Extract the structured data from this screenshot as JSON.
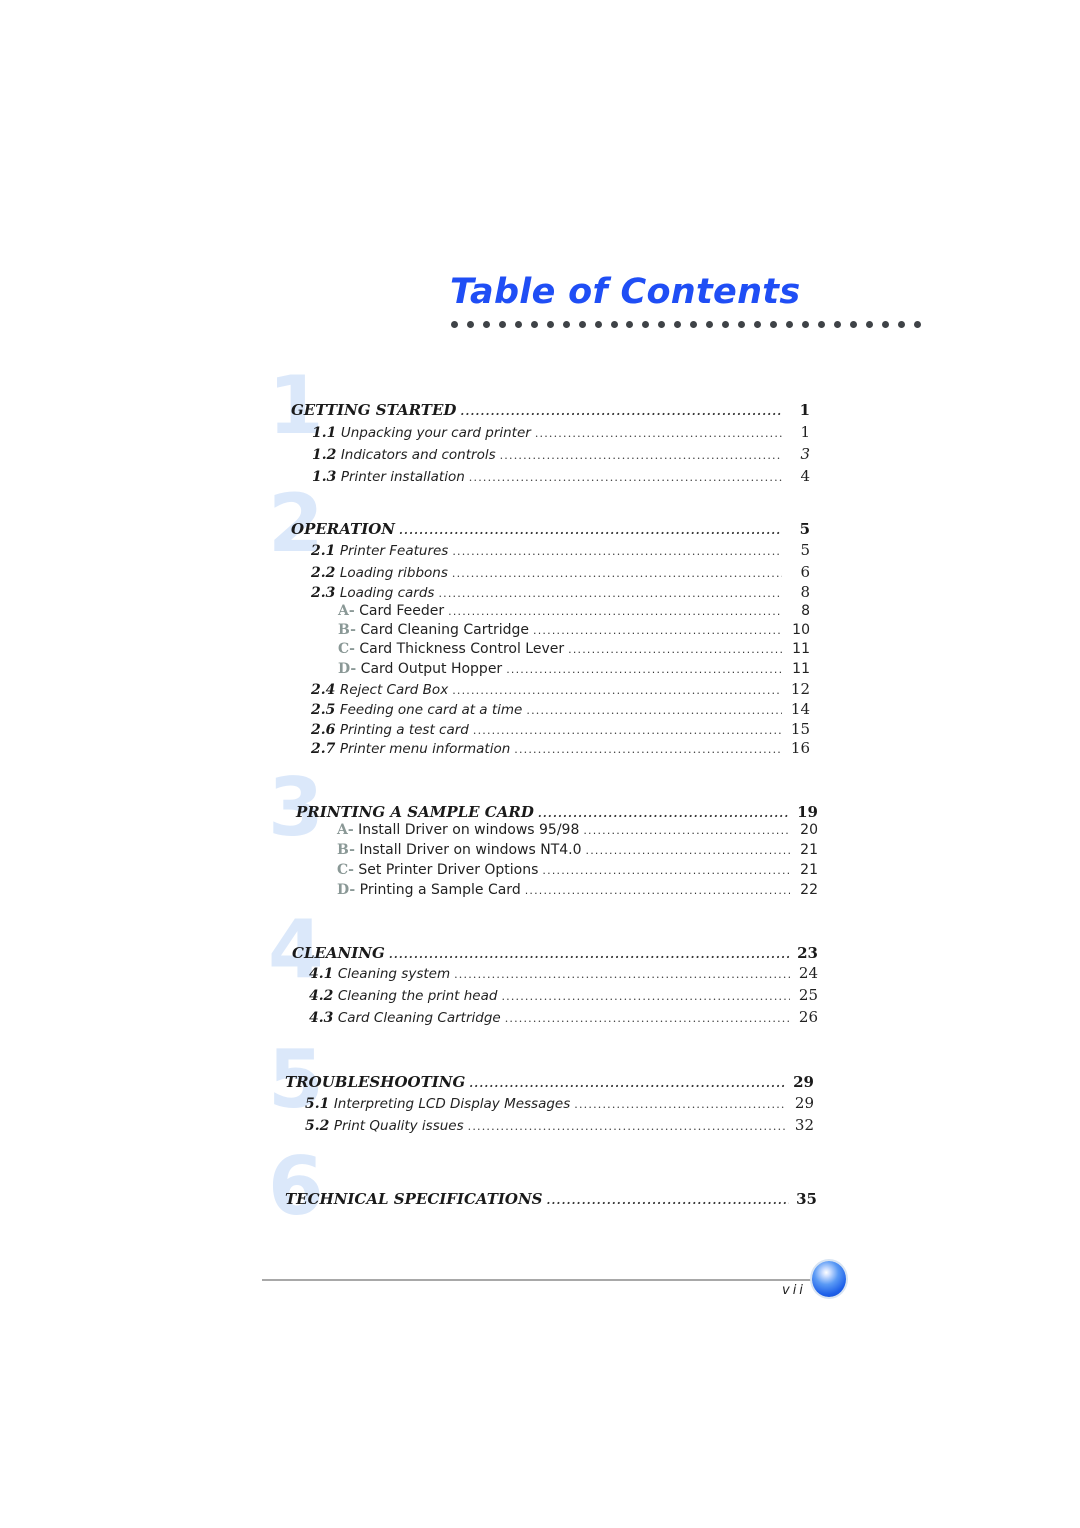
{
  "page": {
    "title": "Table of Contents",
    "folio": "vii",
    "accent_color": "#1f4ef5",
    "chapter_numeral_color": "#dbe8fa"
  },
  "chapters": [
    {
      "number": "1",
      "title": "GETTING STARTED",
      "page": "1",
      "entries": [
        {
          "type": "section",
          "num": "1.1",
          "label": "Unpacking your card printer",
          "page": "1"
        },
        {
          "type": "section",
          "num": "1.2",
          "label": "Indicators and controls",
          "page": "3",
          "page_italic": true
        },
        {
          "type": "section",
          "num": "1.3",
          "label": "Printer installation",
          "page": "4"
        }
      ]
    },
    {
      "number": "2",
      "title": "OPERATION",
      "page": "5",
      "entries": [
        {
          "type": "section",
          "num": "2.1",
          "label": "Printer Features",
          "page": "5"
        },
        {
          "type": "section",
          "num": "2.2",
          "label": "Loading ribbons",
          "page": "6"
        },
        {
          "type": "section",
          "num": "2.3",
          "label": "Loading cards",
          "page": "8"
        },
        {
          "type": "sub",
          "letter": "A-",
          "label": "Card Feeder",
          "page": "8"
        },
        {
          "type": "sub",
          "letter": "B-",
          "label": "Card Cleaning Cartridge",
          "page": "10"
        },
        {
          "type": "sub",
          "letter": "C-",
          "label": "Card Thickness Control Lever",
          "page": "11"
        },
        {
          "type": "sub",
          "letter": "D-",
          "label": "Card Output Hopper",
          "page": "11"
        },
        {
          "type": "section",
          "num": "2.4",
          "label": "Reject Card Box",
          "page": "12"
        },
        {
          "type": "section",
          "num": "2.5",
          "label": "Feeding one card at a time",
          "page": "14"
        },
        {
          "type": "section",
          "num": "2.6",
          "label": "Printing a test card",
          "page": "15"
        },
        {
          "type": "section",
          "num": "2.7",
          "label": "Printer menu information",
          "page": "16"
        }
      ]
    },
    {
      "number": "3",
      "title": "PRINTING A SAMPLE CARD",
      "page": "19",
      "entries": [
        {
          "type": "sub",
          "letter": "A-",
          "label": "Install Driver on windows 95/98",
          "page": "20"
        },
        {
          "type": "sub",
          "letter": "B-",
          "label": "Install Driver on windows NT4.0",
          "page": "21"
        },
        {
          "type": "sub",
          "letter": "C-",
          "label": "Set Printer Driver Options",
          "page": "21"
        },
        {
          "type": "sub",
          "letter": "D-",
          "label": "Printing a Sample Card",
          "page": "22"
        }
      ]
    },
    {
      "number": "4",
      "title": "CLEANING",
      "page": "23",
      "entries": [
        {
          "type": "section",
          "num": "4.1",
          "label": "Cleaning system",
          "page": "24"
        },
        {
          "type": "section",
          "num": "4.2",
          "label": "Cleaning the print head",
          "page": "25"
        },
        {
          "type": "section",
          "num": "4.3",
          "label": "Card Cleaning Cartridge",
          "page": "26"
        }
      ]
    },
    {
      "number": "5",
      "title": "TROUBLESHOOTING",
      "page": "29",
      "entries": [
        {
          "type": "section",
          "num": "5.1",
          "label": "Interpreting LCD Display Messages",
          "page": "29"
        },
        {
          "type": "section",
          "num": "5.2",
          "label": "Print Quality issues",
          "page": "32"
        }
      ]
    },
    {
      "number": "6",
      "title": "TECHNICAL SPECIFICATIONS",
      "page": "35",
      "entries": []
    }
  ]
}
